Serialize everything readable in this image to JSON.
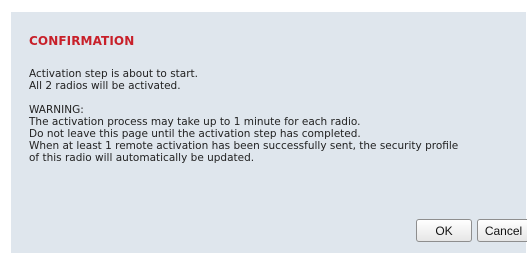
{
  "dialog": {
    "title": "CONFIRMATION",
    "lines": [
      "Activation step is about to start.",
      "All 2 radios will be activated.",
      "",
      "WARNING:",
      "The activation process may take up to 1 minute for each radio.",
      "Do not leave this page until the activation step has completed.",
      "When at least 1 remote activation has been successfully sent, the security profile",
      "of this radio will automatically be updated."
    ],
    "ok_label": "OK",
    "cancel_label": "Cancel"
  },
  "colors": {
    "title": "#c8202a",
    "background": "#dfe6ed",
    "text": "#222222"
  }
}
